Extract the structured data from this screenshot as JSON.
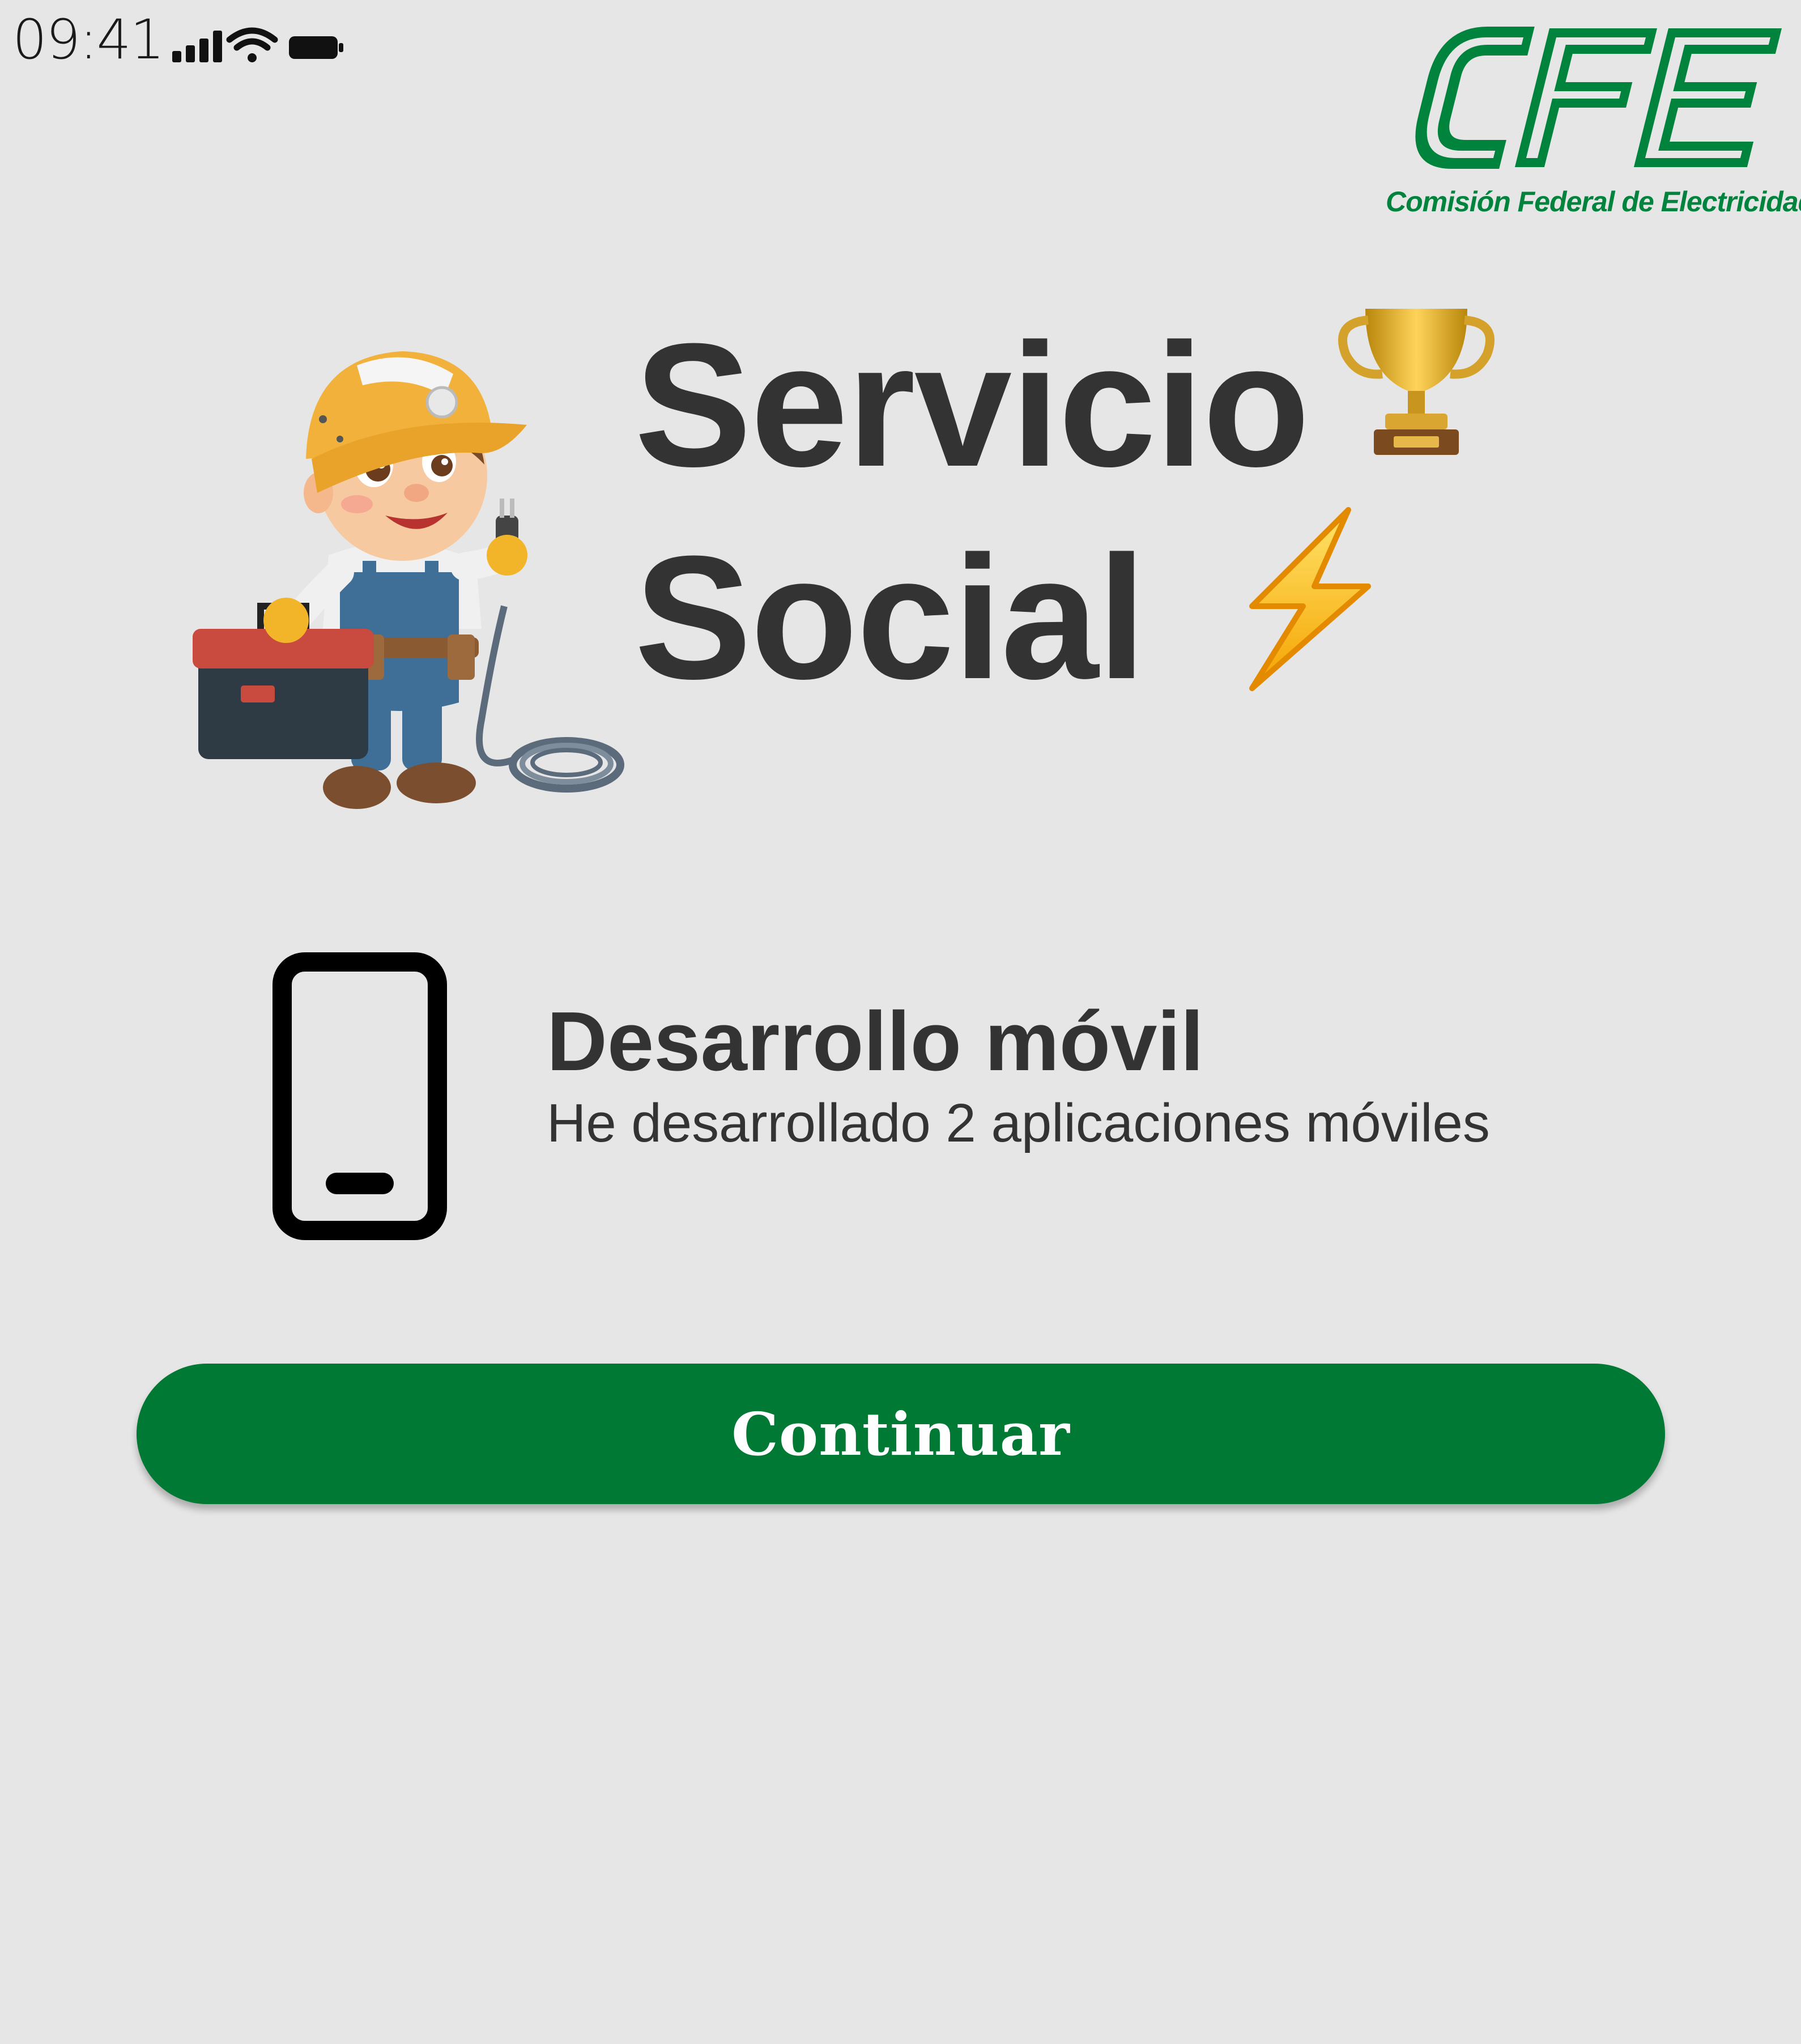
{
  "status_bar": {
    "time": "09:41",
    "icons": [
      "signal-icon",
      "wifi-icon",
      "battery-icon"
    ]
  },
  "logo": {
    "letters": "CFE",
    "caption": "Comisión Federal de Electricidad",
    "color": "#00843d"
  },
  "hero": {
    "title_line1": "Servicio",
    "title_line2": "Social",
    "emoji_trophy": "trophy-icon",
    "emoji_bolt": "lightning-icon",
    "illustration": "electrician-mascot"
  },
  "feature": {
    "icon": "smartphone-icon",
    "title": "Desarrollo móvil",
    "description": "He desarrollado 2 aplicaciones móviles"
  },
  "actions": {
    "continue_label": "Continuar",
    "continue_color": "#007934"
  },
  "colors": {
    "background": "#e6e6e6",
    "text": "#333333"
  }
}
